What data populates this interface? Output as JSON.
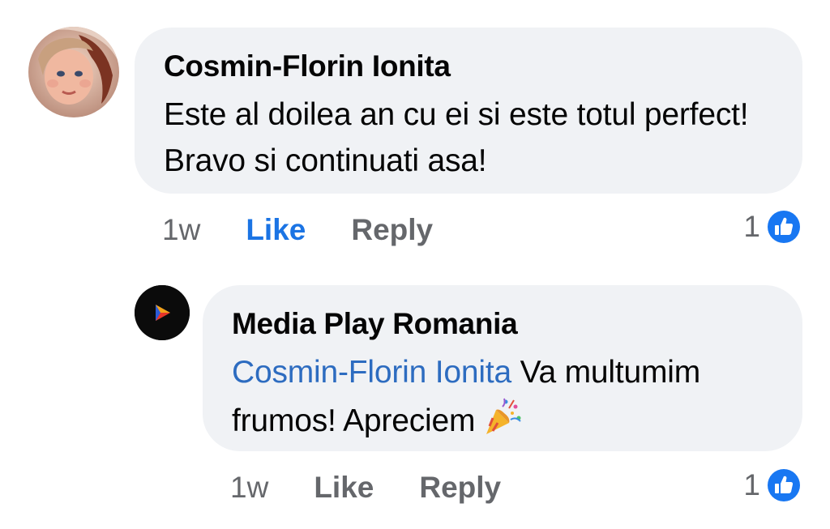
{
  "comment": {
    "author": "Cosmin-Florin Ionita",
    "text": "Este al doilea an cu ei si este totul perfect! Bravo si continuati asa!",
    "time": "1w",
    "like_label": "Like",
    "reply_label": "Reply",
    "reaction_count": "1",
    "reaction_icon": "thumbs-up-icon",
    "avatar_icon": "profile-photo",
    "like_active": true
  },
  "reply": {
    "author": "Media Play Romania",
    "mention": "Cosmin-Florin Ionita",
    "text": "Va multumim frumos! Apreciem",
    "emoji_icon": "party-popper-icon",
    "time": "1w",
    "like_label": "Like",
    "reply_label": "Reply",
    "reaction_count": "1",
    "reaction_icon": "thumbs-up-icon",
    "avatar_icon": "media-play-logo",
    "like_active": false
  },
  "colors": {
    "bubble_bg": "#f0f2f5",
    "like_active": "#1b74e4",
    "secondary_text": "#65676b",
    "mention": "#2d6cc0",
    "reaction_blue": "#1877f2"
  }
}
